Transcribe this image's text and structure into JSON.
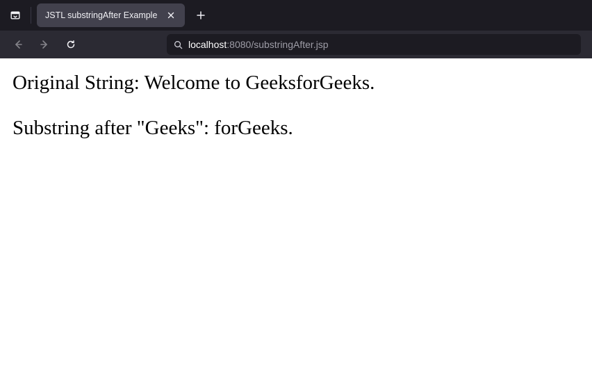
{
  "tab": {
    "title": "JSTL substringAfter Example"
  },
  "url": {
    "host": "localhost",
    "port": ":8080",
    "path": "/substringAfter.jsp"
  },
  "page": {
    "line1": "Original String: Welcome to GeeksforGeeks.",
    "line2": "Substring after \"Geeks\": forGeeks."
  }
}
